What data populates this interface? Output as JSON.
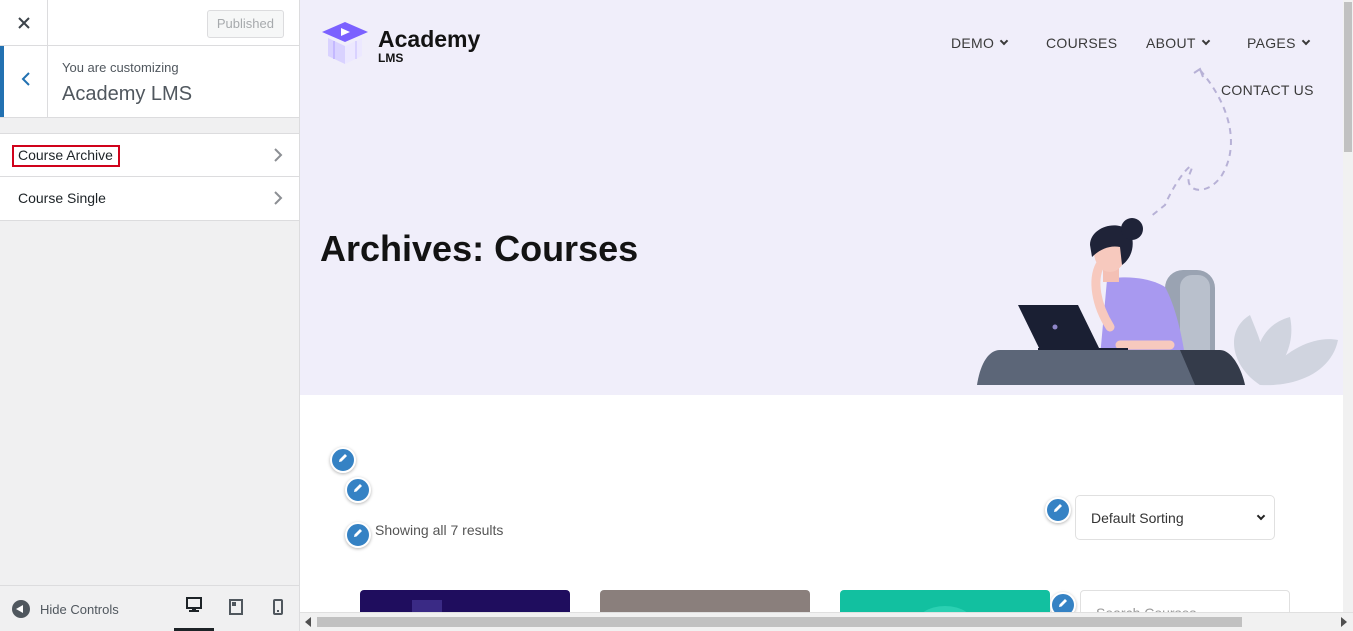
{
  "sidebar": {
    "close_icon": "close-icon",
    "publish_label": "Published",
    "customizing_label": "You are customizing",
    "site_title": "Academy LMS",
    "sections": [
      {
        "label": "Course Archive"
      },
      {
        "label": "Course Single"
      }
    ],
    "footer": {
      "hide_controls_label": "Hide Controls",
      "devices": [
        "desktop-icon",
        "tablet-icon",
        "mobile-icon"
      ]
    }
  },
  "preview": {
    "logo": {
      "main": "Academy",
      "sub": "LMS"
    },
    "nav": {
      "demo": "DEMO",
      "courses": "COURSES",
      "about": "ABOUT",
      "pages": "PAGES",
      "contact": "CONTACT US"
    },
    "page_title": "Archives: Courses",
    "result_count": "Showing all 7 results",
    "sorting": {
      "selected": "Default Sorting"
    },
    "search_placeholder": "Search Courses"
  },
  "colors": {
    "accent": "#2271b1",
    "hero_bg": "#f0eefa",
    "highlight_border": "#d0021b",
    "edit_pencil": "#3582c4"
  }
}
